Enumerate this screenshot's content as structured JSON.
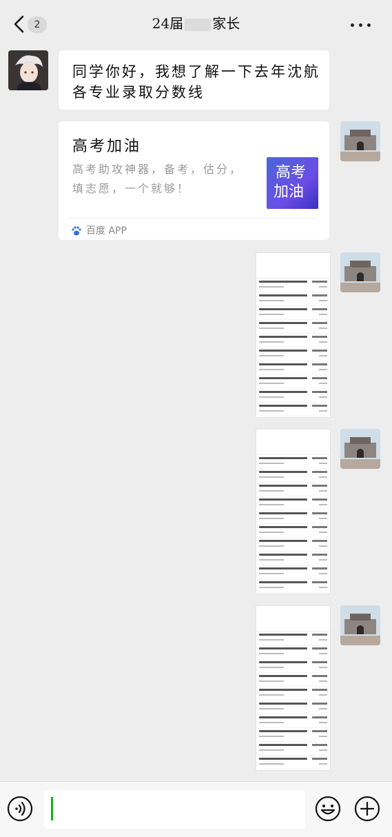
{
  "header": {
    "back_badge": "2",
    "title_prefix": "24届",
    "title_suffix": "家长"
  },
  "messages": {
    "m1": {
      "text": "同学你好，我想了解一下去年沈航各专业录取分数线"
    },
    "card": {
      "title": "高考加油",
      "description": "高考助攻神器，备考，估分，填志愿，一个就够！",
      "thumb_text_1": "高考",
      "thumb_text_2": "加油",
      "source": "百度 APP"
    },
    "screenshots": [
      {
        "label": "screenshot-1"
      },
      {
        "label": "screenshot-2"
      },
      {
        "label": "screenshot-3"
      }
    ]
  },
  "colors": {
    "background": "#ededed",
    "bubble": "#ffffff",
    "caret": "#1aad19"
  },
  "icons": {
    "back": "chevron-left-icon",
    "more": "more-icon",
    "voice": "voice-icon",
    "emoji": "emoji-icon",
    "plus": "plus-icon",
    "source": "baidu-paw-icon"
  }
}
